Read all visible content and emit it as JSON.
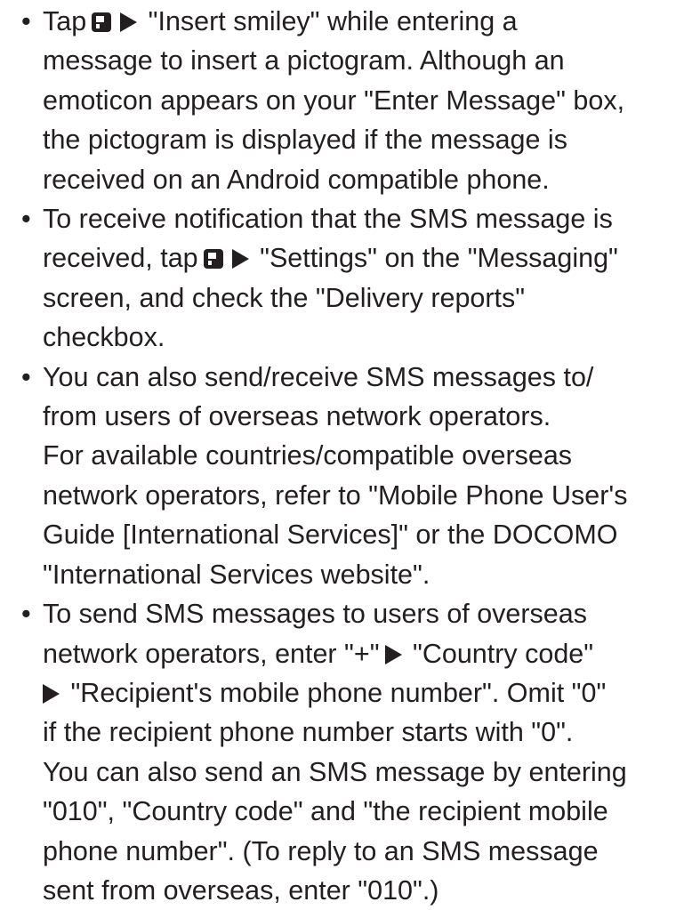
{
  "bullet_char": "•",
  "icons": {
    "menu_key": "menu-key-icon",
    "arrow": "right-triangle-arrow-icon"
  },
  "bullets": [
    {
      "l1a": "Tap",
      "l1b": "\"Insert smiley\" while entering a",
      "l2": "message to insert a pictogram. Although an",
      "l3": "emoticon appears on your \"Enter Message\" box,",
      "l4": "the pictogram is displayed if the message is",
      "l5": "received on an Android compatible phone."
    },
    {
      "l1": "To receive notification that the SMS message is",
      "l2a": "received, tap",
      "l2b": "\"Settings\" on the \"Messaging\"",
      "l3": "screen, and check the \"Delivery reports\"",
      "l4": "checkbox."
    },
    {
      "l1": "You can also send/receive SMS messages to/",
      "l2": "from users of overseas network operators.",
      "l3": "For available countries/compatible overseas",
      "l4": "network operators, refer to \"Mobile Phone User's",
      "l5": "Guide [International Services]\" or the DOCOMO",
      "l6": "\"International Services website\"."
    },
    {
      "l1": "To send SMS messages to users of overseas",
      "l2": "network operators, enter \"+\"",
      "l2b": "\"Country code\"",
      "l3": "\"Recipient's mobile phone number\". Omit \"0\"",
      "l4": "if the recipient phone number starts with \"0\".",
      "l5": "You can also send an SMS message by entering",
      "l6": "\"010\", \"Country code\" and \"the recipient mobile",
      "l7": "phone number\". (To reply to an SMS message",
      "l8": "sent from overseas, enter \"010\".)"
    }
  ]
}
